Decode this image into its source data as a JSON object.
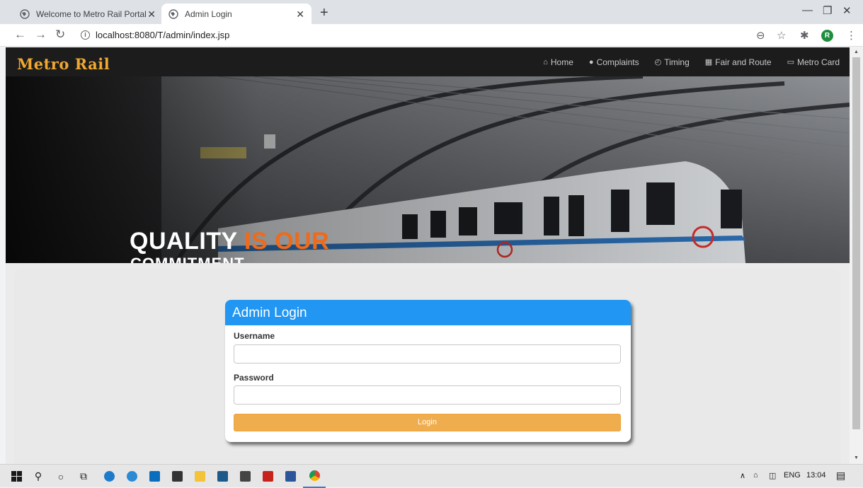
{
  "browser": {
    "tabs": [
      {
        "title": "Welcome to Metro Rail Portal",
        "active": false
      },
      {
        "title": "Admin Login",
        "active": true
      }
    ],
    "url": "localhost:8080/T/admin/index.jsp",
    "profile_initial": "R"
  },
  "site": {
    "brand": "Metro Rail",
    "brand_color": "#f0a830",
    "nav": [
      {
        "icon": "home-icon",
        "label": "Home"
      },
      {
        "icon": "comment-icon",
        "label": "Complaints"
      },
      {
        "icon": "clock-icon",
        "label": "Timing"
      },
      {
        "icon": "map-icon",
        "label": "Fair and Route"
      },
      {
        "icon": "credit-card-icon",
        "label": "Metro Card"
      }
    ]
  },
  "hero": {
    "headline_white": "QUALITY ",
    "headline_orange": "IS OUR",
    "headline_line2": "COMMITMENT",
    "headline_accent": "#ef6a1a",
    "slides": 3,
    "active_slide": 0
  },
  "login": {
    "title": "Admin Login",
    "header_color": "#2196f3",
    "username_label": "Username",
    "username_value": "",
    "password_label": "Password",
    "password_value": "",
    "button_label": "Login",
    "button_color": "#f0ad4e"
  },
  "taskbar": {
    "language": "ENG",
    "time": "13:04"
  }
}
